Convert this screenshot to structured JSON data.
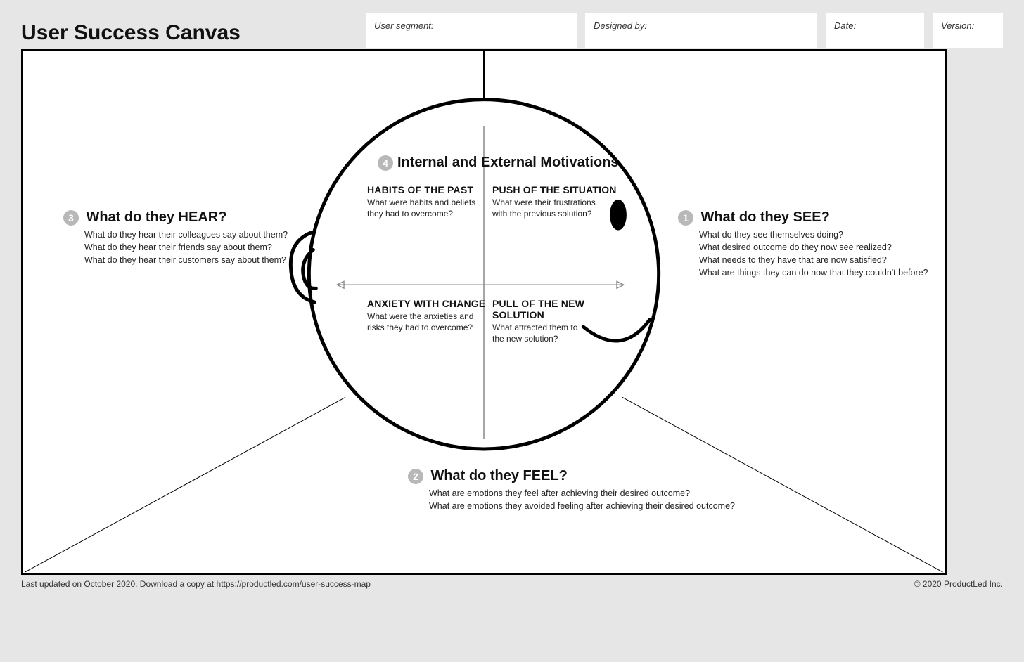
{
  "title": "User Success Canvas",
  "meta": {
    "user_segment_label": "User segment:",
    "designed_by_label": "Designed by:",
    "date_label": "Date:",
    "version_label": "Version:"
  },
  "sections": {
    "see": {
      "num": "1",
      "title": "What do they SEE?",
      "l1": "What do they see themselves doing?",
      "l2": "What desired outcome do they now see realized?",
      "l3": "What needs to they have that are now satisfied?",
      "l4": "What are things they can do now that they couldn't before?"
    },
    "feel": {
      "num": "2",
      "title": "What do they FEEL?",
      "l1": "What are emotions they feel after achieving their desired outcome?",
      "l2": "What are emotions they avoided feeling after achieving their desired outcome?"
    },
    "hear": {
      "num": "3",
      "title": "What do they HEAR?",
      "l1": "What do they hear their colleagues say about them?",
      "l2": "What do they hear their friends say about them?",
      "l3": "What do they hear their customers say about them?"
    },
    "motivations": {
      "num": "4",
      "title": "Internal and External Motivations"
    }
  },
  "quads": {
    "habits": {
      "title": "HABITS OF THE PAST",
      "l1": "What were habits and beliefs",
      "l2": "they had to overcome?"
    },
    "push": {
      "title": "PUSH OF THE SITUATION",
      "l1": "What were their frustrations",
      "l2": "with the previous solution?"
    },
    "anxiety": {
      "title": "ANXIETY WITH CHANGE",
      "l1": "What were the anxieties and",
      "l2": "risks they had to overcome?"
    },
    "pull": {
      "title": "PULL OF THE NEW SOLUTION",
      "l1": "What attracted them to",
      "l2": "the new solution?"
    }
  },
  "footer": {
    "left": "Last updated on October 2020. Download a copy at https://productled.com/user-success-map",
    "right": "© 2020 ProductLed Inc."
  }
}
